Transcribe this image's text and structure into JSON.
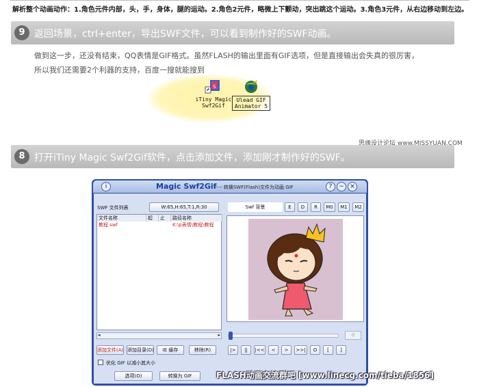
{
  "top_note": "解析整个动画动作：1.角色元件内部，头，手，身体，腿的运动。2.角色2元件，略微上下颤动，突出跳这个运动。3.角色3元件，从右边移动到左边。",
  "step9": {
    "number": "9",
    "text": "返回场景，ctrl+enter，导出SWF文件，可以看到制作好的SWF动画。"
  },
  "paragraph": {
    "line1": "做到这一步，还没有结束，QQ表情是GIF格式。虽然FLASH的输出里面有GIF选项，但是直接输出会失真的很厉害，",
    "line2": "所以我们还需要2个利器的支持，百度一搜就能搜到"
  },
  "desktop_icons": [
    {
      "label_line1": "iTiny Magic",
      "label_line2": "Swf2Gif",
      "icon": "itiny-magic-swf2gif-icon"
    },
    {
      "label_line1": "Ulead GIF",
      "label_line2": "Animator 5",
      "icon": "ulead-gif-animator-icon"
    }
  ],
  "credit_top": "思缘设计论坛  www.MISSYUAN.COM",
  "step8": {
    "number": "8",
    "text": "打开iTiny Magic Swf2Gif软件，点击添加文件，添加刚才制作好的SWF。"
  },
  "app": {
    "title": "Magic  Swf2Gif",
    "subtitle": "----- 转换SWF(Flash)文件为动画 GIF",
    "info_icon": "i",
    "help_icon": "?",
    "minimize_icon": "−",
    "close_icon": "×",
    "file_list_label": "SWF 文件列表",
    "size_info": "W:65,H:65,T:1,R:30",
    "bg_label": "Swf 背景",
    "bg_buttons": [
      "E",
      "D",
      "R",
      "M0",
      "M1",
      "M2"
    ],
    "columns": [
      "文件名称",
      "起",
      "止",
      "路径名称"
    ],
    "rows": [
      {
        "name": "教程.swf",
        "start": "",
        "end": "",
        "path": "K:\\p表情\\教程\\教程"
      }
    ],
    "frame_value": "0",
    "playback_buttons": [
      "|>",
      "||",
      "|<<",
      "<",
      ">",
      ">>|",
      "O",
      "[",
      "]"
    ],
    "add_file": "添加文件(A)",
    "add_dir": "添加目录(D)",
    "cache": "IE 缓存",
    "remove": "移除(R)",
    "optimize_label": "优化 GIF 以减小其大小",
    "options": "选项(O)",
    "convert": "转换为 GIF"
  },
  "watermark": "FLASH动画交流群吧 [www.linecg.com/tieba/1856]",
  "colors": {
    "step_bar": "#c4c4c4",
    "window_frame": "#2c4fa8",
    "title_text": "#1b3e9e",
    "stage_bg": "#d8c0d0",
    "file_name": "#cc2222"
  }
}
